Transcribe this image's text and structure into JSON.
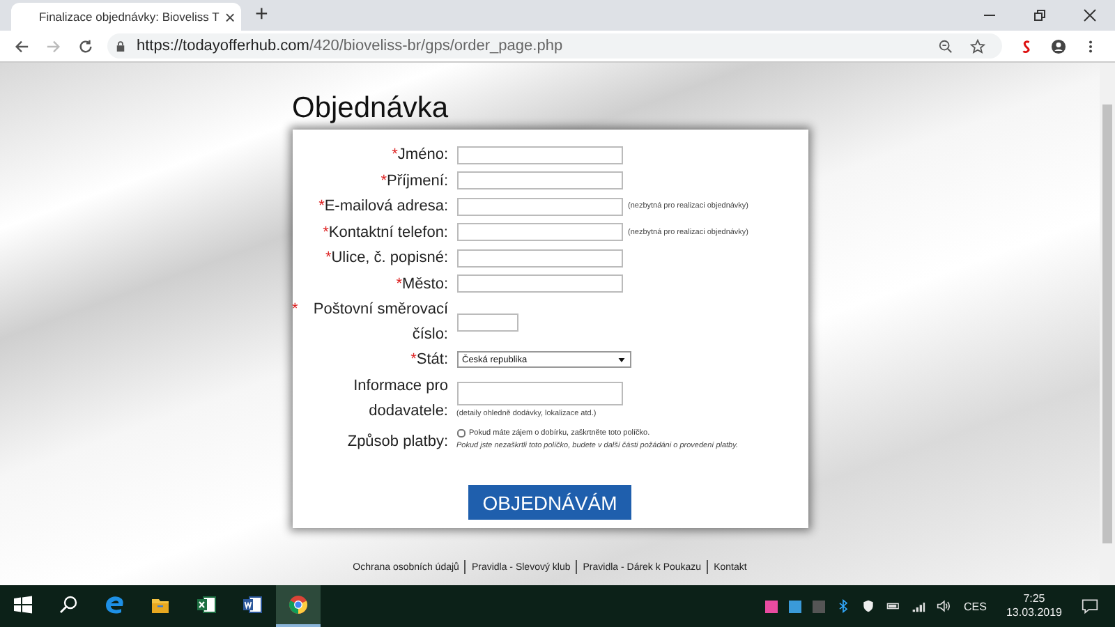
{
  "browser": {
    "tab": {
      "title": "Finalizace objednávky: Bioveliss T",
      "close": "×"
    },
    "new_tab": "+",
    "url": {
      "host": "https://todayofferhub.com",
      "path": "/420/bioveliss-br/gps/order_page.php"
    }
  },
  "page": {
    "title": "Objednávka",
    "fields": [
      {
        "kind": "text",
        "required_mark": "*",
        "label": "Jméno:"
      },
      {
        "kind": "text",
        "required_mark": "*",
        "label": "Příjmení:"
      },
      {
        "kind": "text",
        "required_mark": "*",
        "label": "E-mailová adresa:",
        "note": "(nezbytná pro realizaci objednávky)"
      },
      {
        "kind": "text",
        "required_mark": "*",
        "label": "Kontaktní telefon:",
        "note": "(nezbytná pro realizaci objednávky)"
      },
      {
        "kind": "text",
        "required_mark": "*",
        "label": "Ulice, č. popisné:"
      },
      {
        "kind": "text",
        "required_mark": "*",
        "label": "Město:"
      },
      {
        "kind": "short",
        "required_mark": "*",
        "label": "Poštovní směrovací číslo:"
      },
      {
        "kind": "select",
        "required_mark": "*",
        "label": "Stát:",
        "value": "Česká republika"
      },
      {
        "kind": "textarea",
        "label": "Informace pro dodavatele:",
        "note": "(detaily ohledně dodávky, lokalizace atd.)"
      },
      {
        "kind": "checkbox",
        "label": "Způsob platby:",
        "checked": false,
        "text": "Pokud máte zájem o dobírku, zaškrtněte toto políčko.",
        "note": "Pokud jste nezaškrtli toto políčko, budete v další části požádáni o provedení platby."
      }
    ],
    "submit": "OBJEDNÁVÁM",
    "footer_links": [
      "Ochrana osobních údajů",
      "Pravidla - Slevový klub",
      "Pravidla - Dárek k Poukazu",
      "Kontakt"
    ]
  },
  "taskbar": {
    "apps": [
      {
        "kind": "start",
        "selected": false
      },
      {
        "kind": "search",
        "selected": false
      },
      {
        "kind": "edge",
        "selected": false
      },
      {
        "kind": "folder",
        "selected": false
      },
      {
        "kind": "excel",
        "selected": false
      },
      {
        "kind": "word",
        "selected": false
      },
      {
        "kind": "chrome",
        "selected": true
      }
    ],
    "language": "CES",
    "time": "7:25",
    "date": "13.03.2019"
  }
}
